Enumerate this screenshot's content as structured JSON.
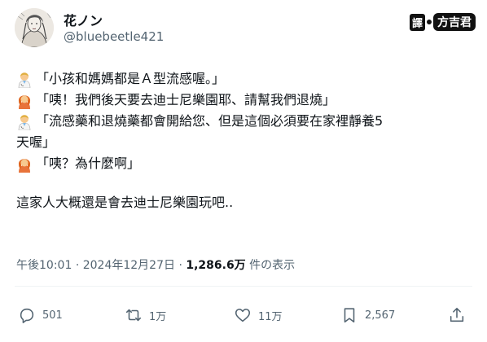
{
  "author": {
    "display_name": "花ノン",
    "handle": "@bluebeetle421",
    "avatar_icon": "sketch-portrait-avatar"
  },
  "watermark": {
    "box_label": "譯",
    "rest_label": "方吉君"
  },
  "tweet": {
    "lines": [
      {
        "speaker_icon": "doctor-emoji",
        "text": "「小孩和媽媽都是Ａ型流感喔。」"
      },
      {
        "speaker_icon": "woman-emoji",
        "text": "「咦！我們後天要去迪士尼樂園耶、請幫我們退燒」"
      },
      {
        "speaker_icon": "doctor-emoji",
        "text": "「流感藥和退燒藥都會開給您、但是這個必須要在家裡靜養5"
      },
      {
        "continuation": "天喔」"
      },
      {
        "speaker_icon": "woman-emoji",
        "text": "「咦？為什麼啊」"
      }
    ],
    "closing": "這家人大概還是會去迪士尼樂園玩吧.."
  },
  "meta": {
    "time": "午後10:01",
    "separator": "·",
    "date": "2024年12月27日",
    "views": "1,286.6万",
    "views_label": "件の表示"
  },
  "actions": {
    "replies": "501",
    "reposts": "1万",
    "likes": "11万",
    "bookmarks": "2,567"
  },
  "colors": {
    "text": "#0f1419",
    "secondary": "#536471",
    "divider": "#eff3f4"
  }
}
